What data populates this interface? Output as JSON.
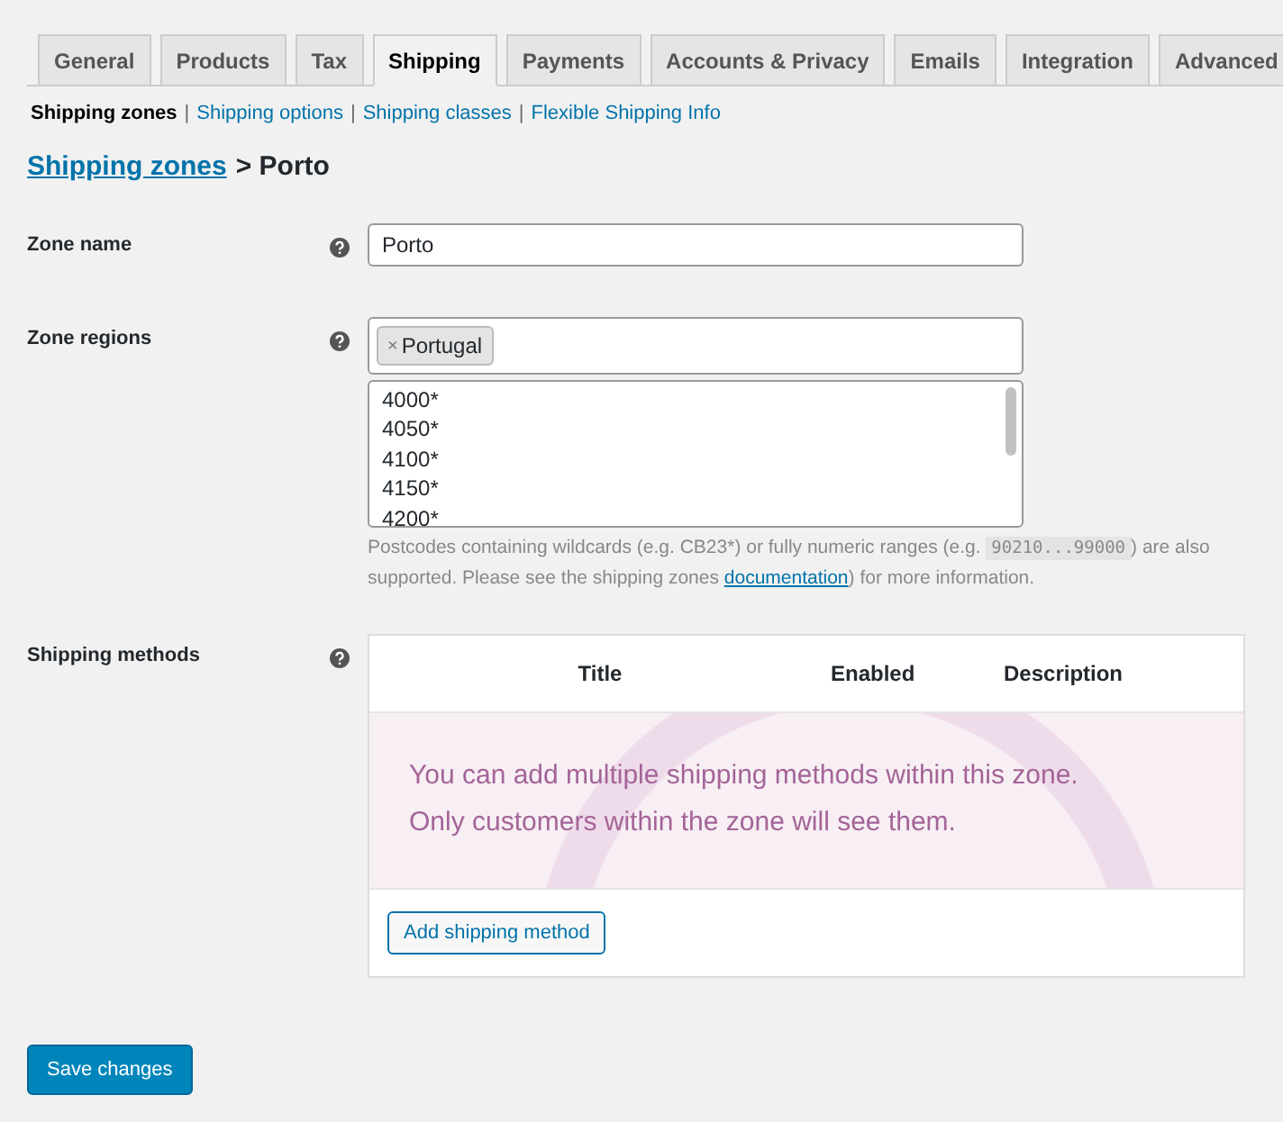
{
  "tabs": [
    {
      "label": "General",
      "selected": false
    },
    {
      "label": "Products",
      "selected": false
    },
    {
      "label": "Tax",
      "selected": false
    },
    {
      "label": "Shipping",
      "selected": true
    },
    {
      "label": "Payments",
      "selected": false
    },
    {
      "label": "Accounts & Privacy",
      "selected": false
    },
    {
      "label": "Emails",
      "selected": false
    },
    {
      "label": "Integration",
      "selected": false
    },
    {
      "label": "Advanced",
      "selected": false
    }
  ],
  "subnav": [
    {
      "label": "Shipping zones",
      "selected": true
    },
    {
      "label": "Shipping options",
      "selected": false
    },
    {
      "label": "Shipping classes",
      "selected": false
    },
    {
      "label": "Flexible Shipping Info",
      "selected": false
    }
  ],
  "separator": "|",
  "heading": {
    "link": "Shipping zones",
    "rest": "> Porto"
  },
  "zone_name": {
    "label": "Zone name",
    "value": "Porto"
  },
  "zone_regions": {
    "label": "Zone regions",
    "tags": [
      {
        "remove": "×",
        "label": "Portugal"
      }
    ],
    "postcodes": [
      "4000*",
      "4050*",
      "4100*",
      "4150*",
      "4200*"
    ],
    "description": {
      "before": "Postcodes containing wildcards (e.g. CB23*) or fully numeric ranges (e.g.",
      "code": "90210...99000",
      "middle": ") are also supported. Please see the shipping zones",
      "link": "documentation",
      "after": ") for more information."
    }
  },
  "shipping_methods": {
    "label": "Shipping methods",
    "columns": [
      "Title",
      "Enabled",
      "Description"
    ],
    "empty_message": [
      "You can add multiple shipping methods within this zone.",
      "Only customers within the zone will see them."
    ],
    "add_button": "Add shipping method"
  },
  "save_button": "Save changes"
}
